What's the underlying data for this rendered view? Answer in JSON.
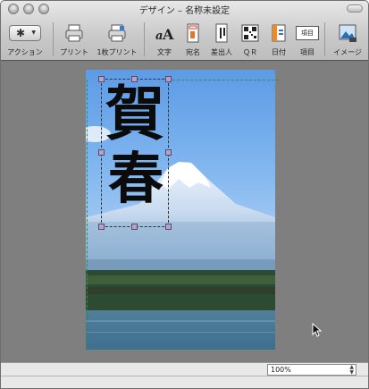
{
  "window": {
    "title": "デザイン – 名称未設定"
  },
  "toolbar": {
    "action_label": "アクション",
    "print_label": "プリント",
    "print_one_label": "1枚プリント",
    "text_label": "文字",
    "address_label": "宛名",
    "sender_label": "差出人",
    "qr_label": "ＱＲ",
    "date_label": "日付",
    "field_label": "項目",
    "field_icon_text": "項目",
    "image_label": "イメージ"
  },
  "design": {
    "greeting_char_1": "賀",
    "greeting_char_2": "春"
  },
  "status": {
    "zoom": "100%"
  },
  "colors": {
    "guide": "#2f8f4f",
    "handle": "#b7a3c9",
    "sky": "#7bb2ee"
  }
}
